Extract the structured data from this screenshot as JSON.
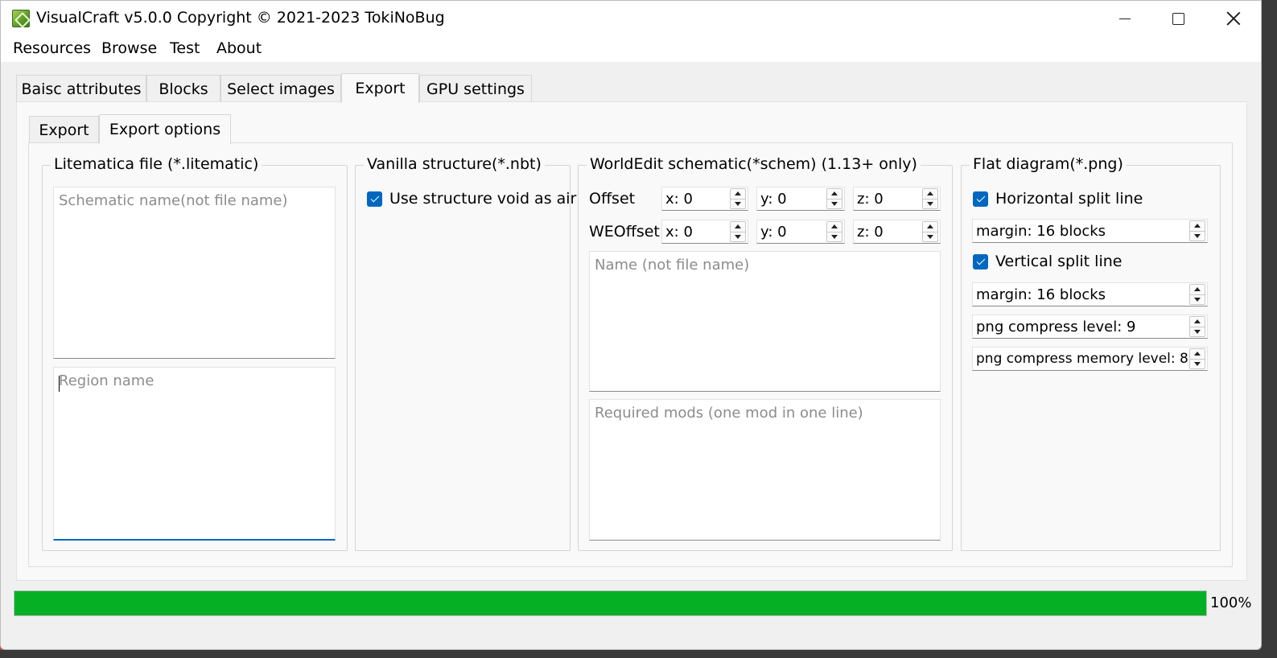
{
  "window": {
    "title": "VisualCraft v5.0.0  Copyright © 2021-2023 TokiNoBug"
  },
  "menu": [
    "Resources",
    "Browse",
    "Test",
    "About"
  ],
  "main_tabs": [
    "Baisc attributes",
    "Blocks",
    "Select images",
    "Export",
    "GPU settings"
  ],
  "main_tabs_active": "Export",
  "sub_tabs": [
    "Export",
    "Export options"
  ],
  "sub_tabs_active": "Export options",
  "litematica": {
    "title": "Litematica file (*.litematic)",
    "schematic_name_placeholder": "Schematic name(not file name)",
    "region_name_placeholder": "Region name"
  },
  "vanilla": {
    "title": "Vanilla structure(*.nbt)",
    "use_void_label": "Use structure void as air",
    "use_void_checked": true
  },
  "worldedit": {
    "title": "WorldEdit schematic(*schem) (1.13+ only)",
    "offset_label": "Offset",
    "weoffset_label": "WEOffset",
    "offset": [
      "x: 0",
      "y: 0",
      "z: 0"
    ],
    "weoffset": [
      "x: 0",
      "y: 0",
      "z: 0"
    ],
    "name_placeholder": "Name (not file name)",
    "mods_placeholder": "Required mods (one mod in one line)"
  },
  "flat": {
    "title": "Flat diagram(*.png)",
    "horizontal_label": "Horizontal split line",
    "horizontal_checked": true,
    "horizontal_margin": "margin: 16 blocks",
    "vertical_label": "Vertical split line",
    "vertical_checked": true,
    "vertical_margin": "margin: 16 blocks",
    "compress_level": "png compress level: 9",
    "compress_memory": "png compress memory level: 8"
  },
  "progress": {
    "value": 100,
    "text": "100%"
  },
  "colors": {
    "accent": "#0067c0",
    "progress": "#06b025"
  }
}
